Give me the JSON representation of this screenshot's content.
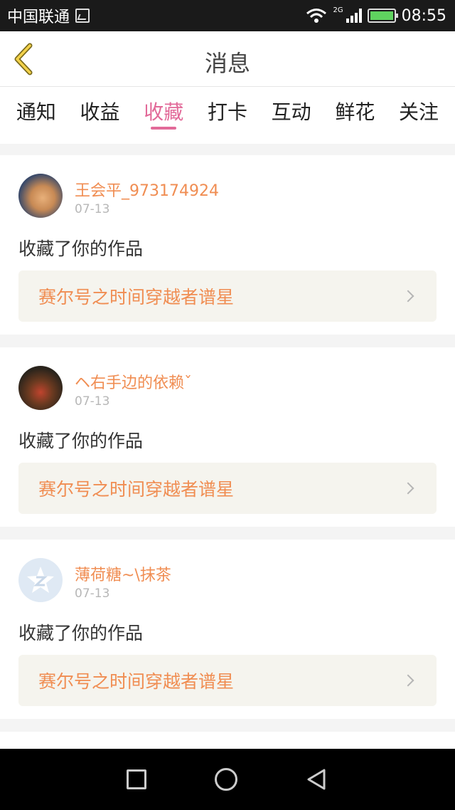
{
  "status_bar": {
    "carrier": "中国联通",
    "network": "2G",
    "time": "08:55"
  },
  "header": {
    "title": "消息",
    "back_icon": "chevron-left-icon"
  },
  "tabs": [
    {
      "label": "通知",
      "active": false
    },
    {
      "label": "收益",
      "active": false
    },
    {
      "label": "收藏",
      "active": true
    },
    {
      "label": "打卡",
      "active": false
    },
    {
      "label": "互动",
      "active": false
    },
    {
      "label": "鲜花",
      "active": false
    },
    {
      "label": "关注",
      "active": false
    }
  ],
  "messages": [
    {
      "username": "王会平_973174924",
      "date": "07-13",
      "action": "收藏了你的作品",
      "work_title": "赛尔号之时间穿越者谱星",
      "avatar": "cat-photo"
    },
    {
      "username": "ヘ右手边的依赖ˇ",
      "date": "07-13",
      "action": "收藏了你的作品",
      "work_title": "赛尔号之时间穿越者谱星",
      "avatar": "toy-photo"
    },
    {
      "username": "薄荷糖~\\抹茶",
      "date": "07-13",
      "action": "收藏了你的作品",
      "work_title": "赛尔号之时间穿越者谱星",
      "avatar": "qq-default"
    }
  ],
  "colors": {
    "accent": "#e26a99",
    "username": "#f08d52",
    "work_bg": "#f5f4ee"
  }
}
